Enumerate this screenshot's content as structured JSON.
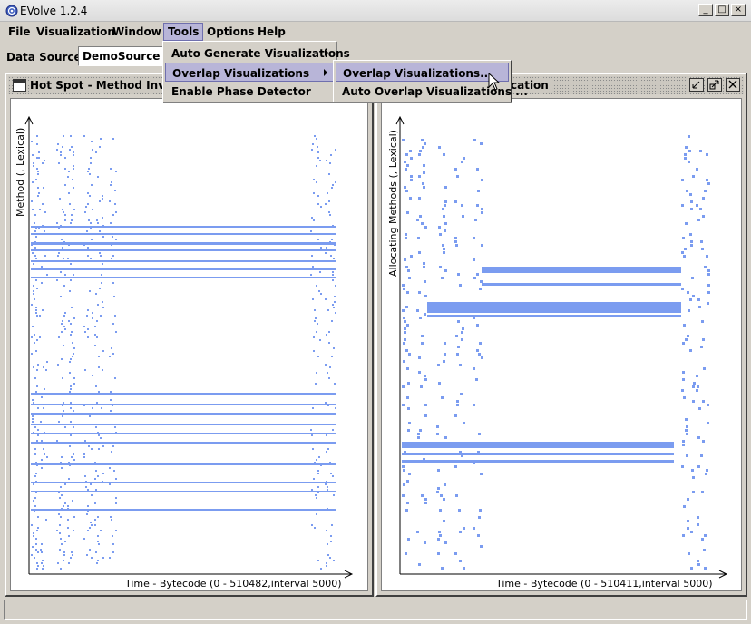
{
  "window": {
    "title": "EVolve 1.2.4",
    "buttons": [
      "_",
      "□",
      "×"
    ]
  },
  "menubar": {
    "items": [
      "File",
      "Visualization",
      "Window",
      "Tools",
      "Options",
      "Help"
    ],
    "active": "Tools"
  },
  "toolbar": {
    "data_source_label": "Data Source:",
    "data_source_value": "DemoSource - h"
  },
  "tools_menu": {
    "items": [
      {
        "label": "Auto Generate Visualizations",
        "submenu": true
      },
      {
        "label": "Overlap Visualizations",
        "submenu": true,
        "selected": true
      },
      {
        "label": "Enable Phase Detector",
        "submenu": false
      }
    ]
  },
  "overlap_submenu": {
    "items": [
      {
        "label": "Overlap Visualizations...",
        "selected": true
      },
      {
        "label": "Auto Overlap Visualizations ..."
      }
    ]
  },
  "frames": {
    "left": {
      "title": "Hot Spot - Method Invocat",
      "ylabel": "Method (, Lexical)",
      "xlabel": "Time - Bytecode (0 - 510482,interval 5000)"
    },
    "right": {
      "title": "cation",
      "ylabel": "Allocating Methods (, Lexical)",
      "xlabel": "Time - Bytecode (0 - 510411,interval 5000)"
    }
  },
  "colors": {
    "plot_mark": "#7b9cf0",
    "menu_highlight": "#b8b5d8",
    "chrome": "#d4d0c8"
  },
  "icons": [
    "app-icon",
    "minimize-icon",
    "maximize-icon",
    "close-icon",
    "frame-icon",
    "submenu-arrow-icon",
    "mouse-cursor-icon"
  ]
}
